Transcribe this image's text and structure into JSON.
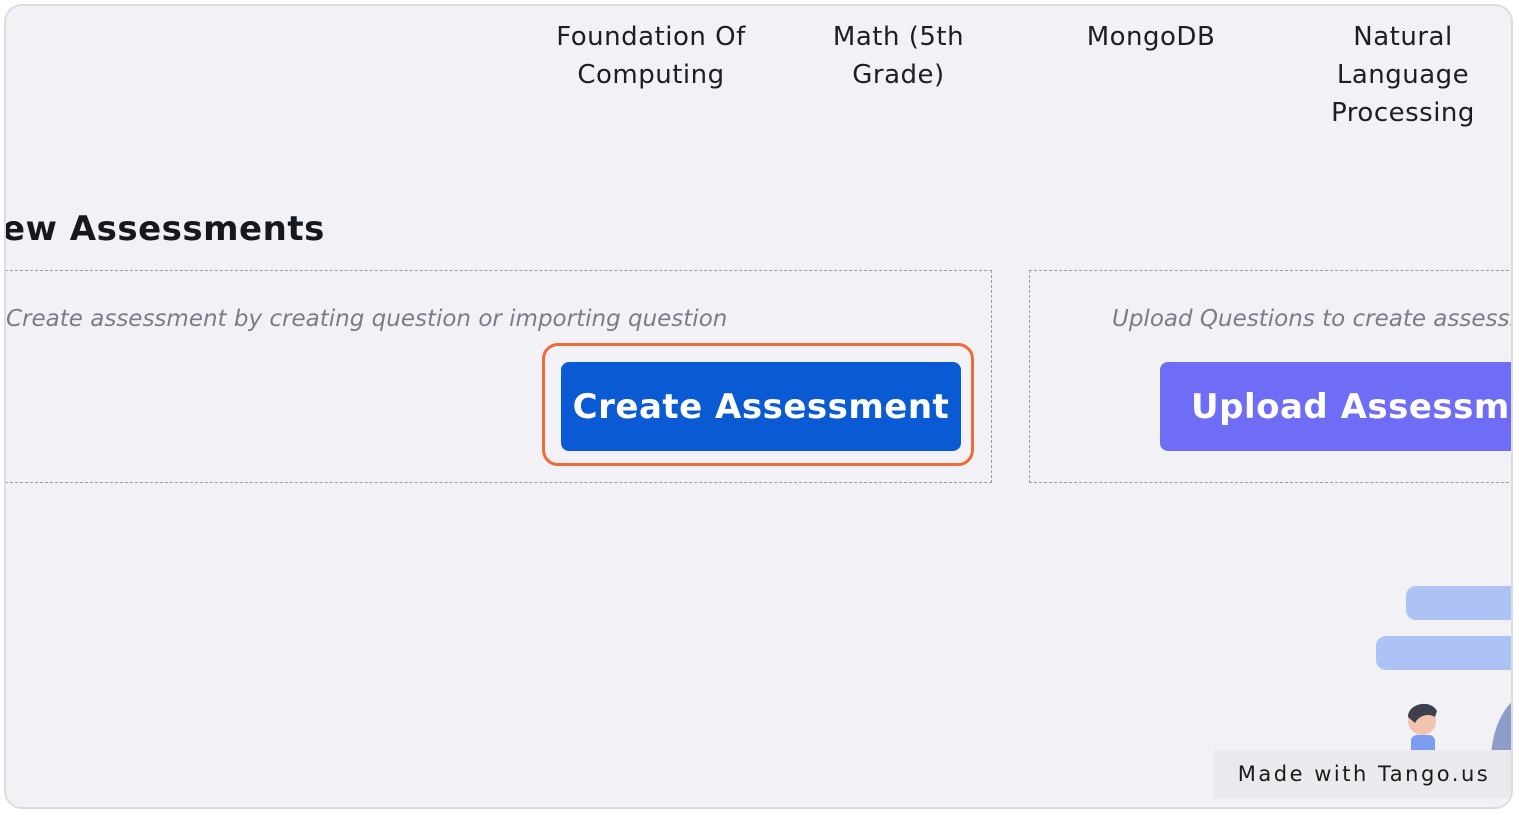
{
  "topics": {
    "foundation": "Foundation Of\nComputing",
    "math": "Math (5th\nGrade)",
    "mongodb": "MongoDB",
    "nlp": "Natural\nLanguage\nProcessing"
  },
  "section": {
    "title": "ew Assessments"
  },
  "create_card": {
    "description": "Create assessment by creating question or importing question",
    "button_label": "Create Assessment"
  },
  "upload_card": {
    "description": "Upload Questions to create assessment",
    "button_label": "Upload Assessment"
  },
  "watermark": {
    "text": "Made with Tango.us"
  },
  "colors": {
    "create_button": "#0a5bd3",
    "upload_button": "#6f6cf6",
    "highlight_ring": "#ee6a3a",
    "page_background": "#f2f2f6"
  }
}
